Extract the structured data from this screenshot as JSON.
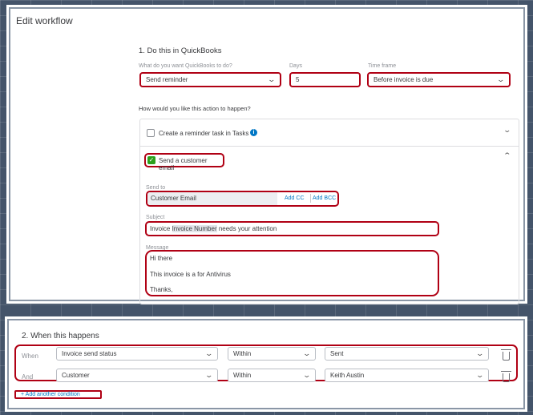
{
  "title": "Edit workflow",
  "section1": {
    "title": "1. Do this in QuickBooks",
    "action_label": "What do you want QuickBooks to do?",
    "action_value": "Send reminder",
    "days_label": "Days",
    "days_value": "5",
    "timeframe_label": "Time frame",
    "timeframe_value": "Before invoice is due",
    "how_label": "How would you like this action to happen?",
    "task_option": "Create a reminder task in Tasks",
    "email_option": "Send a customer email",
    "send_to_label": "Send to",
    "send_to_value": "Customer Email",
    "add_cc": "Add CC",
    "add_bcc": "Add BCC",
    "subject_label": "Subject",
    "subject_prefix": "Invoice ",
    "subject_token": "Invoice Number",
    "subject_suffix": " needs your attention",
    "message_label": "Message",
    "message_lines": [
      "Hi there",
      "This invoice is a for Antivirus",
      "Thanks,"
    ]
  },
  "section2": {
    "title": "2. When this happens",
    "conditions": [
      {
        "prefix": "When",
        "field": "Invoice send status",
        "operator": "Within",
        "value": "Sent"
      },
      {
        "prefix": "And",
        "field": "Customer",
        "operator": "Within",
        "value": "Keith Austin"
      }
    ],
    "add_condition": "+ Add another condition"
  },
  "colors": {
    "highlight": "#b00014",
    "check": "#2ca01c",
    "link": "#0077c5"
  }
}
